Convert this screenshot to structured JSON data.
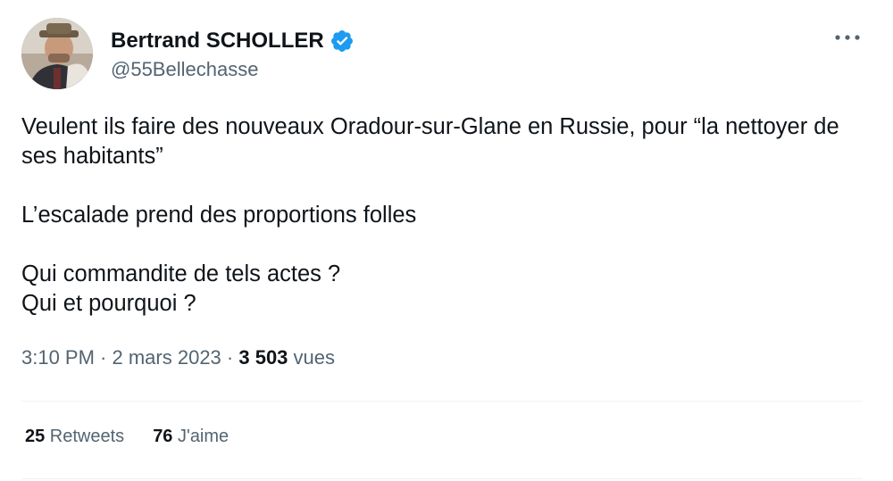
{
  "author": {
    "name": "Bertrand SCHOLLER",
    "handle": "@55Bellechasse",
    "avatar_icon": "user-avatar-photo",
    "verified_icon": "verified-badge-icon",
    "verified_color": "#1d9bf0"
  },
  "more_icon": "more-options-icon",
  "tweet": {
    "line1": "Veulent ils faire des nouveaux Oradour-sur-Glane en Russie, pour “la nettoyer de ses habitants”",
    "line2": "L’escalade prend des proportions folles",
    "line3": "Qui commandite de tels actes ?",
    "line4": "Qui et pourquoi ?"
  },
  "meta": {
    "time": "3:10 PM",
    "separator1": " · ",
    "date": "2 mars 2023",
    "separator2": " · ",
    "views_count": "3 503",
    "views_label": " vues"
  },
  "stats": {
    "retweets_count": "25",
    "retweets_label": " Retweets",
    "likes_count": "76",
    "likes_label": " J'aime"
  },
  "colors": {
    "text_primary": "#0f1419",
    "text_secondary": "#536471",
    "divider": "#eff3f4",
    "accent": "#1d9bf0"
  }
}
